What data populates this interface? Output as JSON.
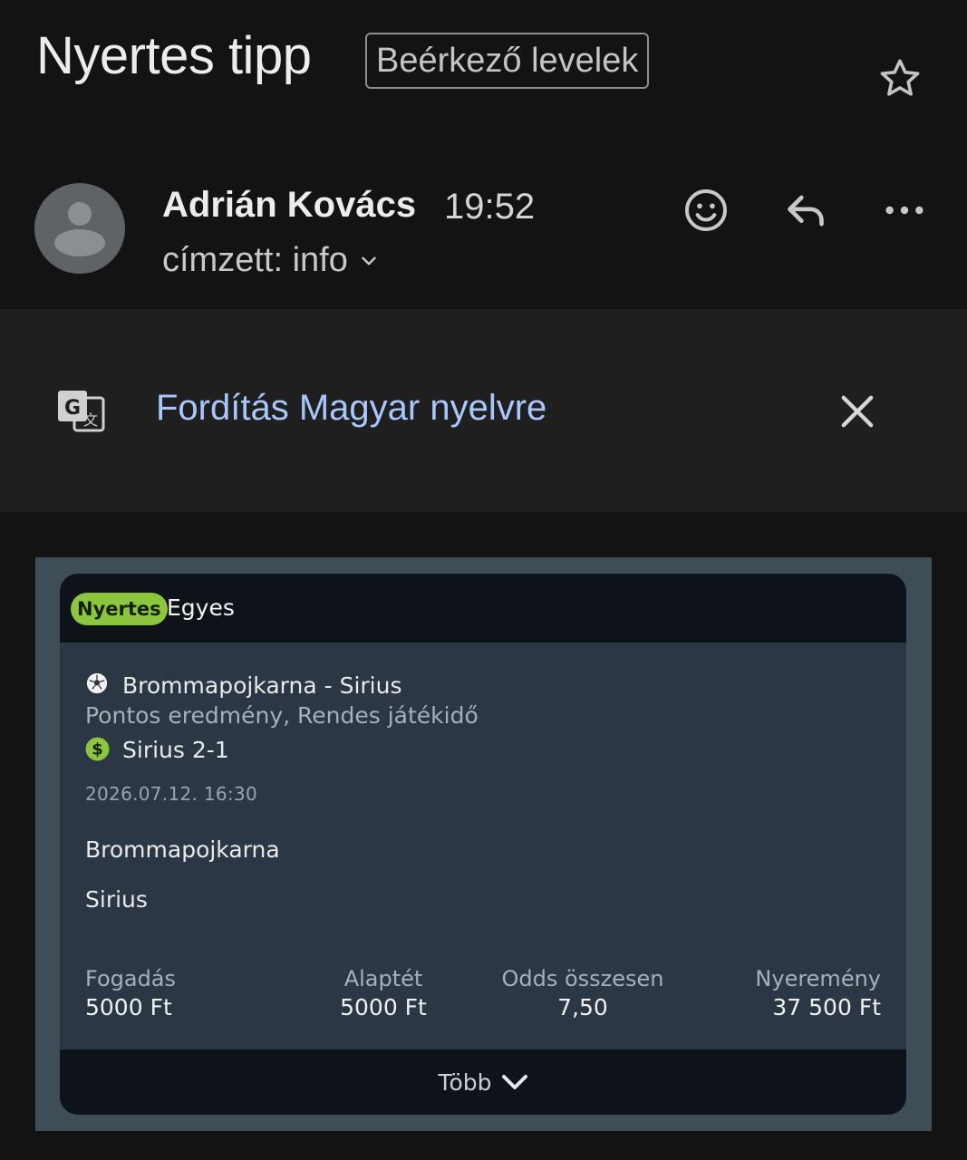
{
  "header": {
    "subject": "Nyertes tipp",
    "label": "Beérkező levelek",
    "sender_name": "Adrián Kovács",
    "time": "19:52",
    "recipient": "címzett: info"
  },
  "translate": {
    "text": "Fordítás Magyar nyelvre"
  },
  "bet": {
    "status": "Nyertes",
    "type": "Egyes",
    "match": "Brommapojkarna - Sirius",
    "market": "Pontos eredmény, Rendes játékidő",
    "selection": "Sirius 2-1",
    "datetime": "2026.07.12.  16:30",
    "team_home": "Brommapojkarna",
    "team_away": "Sirius",
    "stats": [
      {
        "label": "Fogadás",
        "value": "5000 Ft"
      },
      {
        "label": "Alaptét",
        "value": "5000 Ft"
      },
      {
        "label": "Odds összesen",
        "value": "7,50"
      },
      {
        "label": "Nyeremény",
        "value": "37 500 Ft"
      }
    ],
    "more_label": "Több"
  },
  "colors": {
    "background": "#131313",
    "link": "#a8c7fa",
    "badge": "#8cc63f",
    "card": "#2b3744"
  }
}
